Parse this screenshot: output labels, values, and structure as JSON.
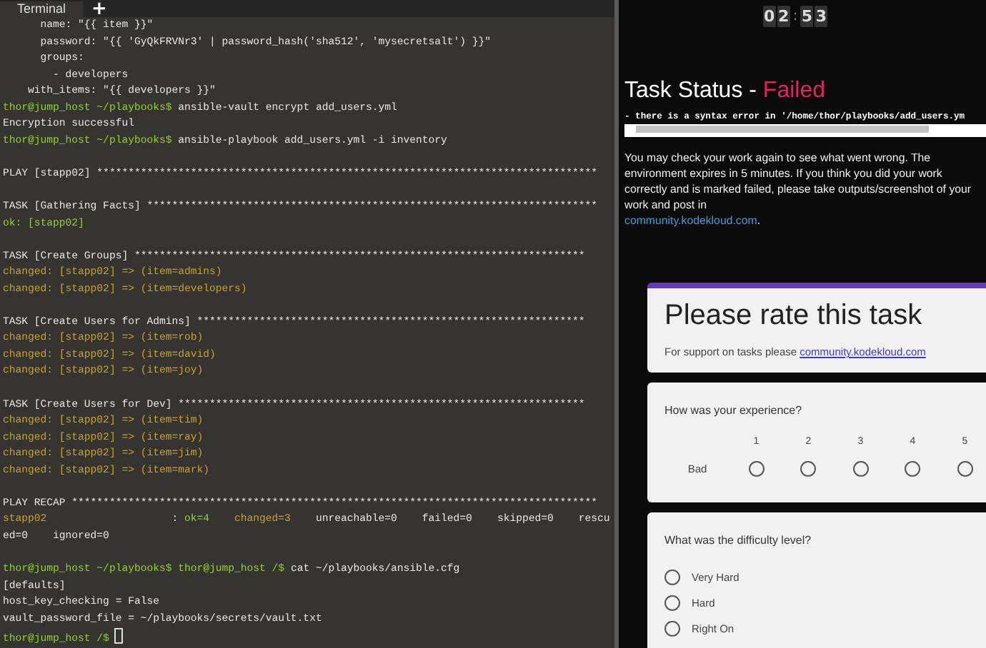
{
  "terminal": {
    "tabs": [
      {
        "label": "Terminal",
        "selected": true
      }
    ],
    "add_tab": "+",
    "lines": [
      {
        "kind": "text",
        "segments": [
          {
            "kind": "plain",
            "text": "      name: \"{{ item }}\""
          }
        ]
      },
      {
        "kind": "text",
        "segments": [
          {
            "kind": "plain",
            "text": "      password: \"{{ 'GyQkFRVNr3' | password_hash('sha512', 'mysecretsalt') }}\""
          }
        ]
      },
      {
        "kind": "text",
        "segments": [
          {
            "kind": "plain",
            "text": "      groups:"
          }
        ]
      },
      {
        "kind": "text",
        "segments": [
          {
            "kind": "plain",
            "text": "        - developers"
          }
        ]
      },
      {
        "kind": "text",
        "segments": [
          {
            "kind": "plain",
            "text": "    with_items: \"{{ developers }}\""
          }
        ]
      },
      {
        "kind": "text",
        "segments": [
          {
            "kind": "prompt",
            "text": "thor@jump_host ~/playbooks$"
          },
          {
            "kind": "plain",
            "text": " ansible-vault encrypt add_users.yml"
          }
        ]
      },
      {
        "kind": "text",
        "segments": [
          {
            "kind": "plain",
            "text": "Encryption successful"
          }
        ]
      },
      {
        "kind": "text",
        "segments": [
          {
            "kind": "prompt",
            "text": "thor@jump_host ~/playbooks$"
          },
          {
            "kind": "plain",
            "text": " ansible-playbook add_users.yml -i inventory"
          }
        ]
      },
      {
        "kind": "blank"
      },
      {
        "kind": "text",
        "segments": [
          {
            "kind": "plain",
            "text": "PLAY [stapp02] ********************************************************************************"
          }
        ]
      },
      {
        "kind": "blank"
      },
      {
        "kind": "text",
        "segments": [
          {
            "kind": "plain",
            "text": "TASK [Gathering Facts] ************************************************************************"
          }
        ]
      },
      {
        "kind": "text",
        "segments": [
          {
            "kind": "ok",
            "text": "ok: [stapp02]"
          }
        ]
      },
      {
        "kind": "blank"
      },
      {
        "kind": "text",
        "segments": [
          {
            "kind": "plain",
            "text": "TASK [Create Groups] ************************************************************************"
          }
        ]
      },
      {
        "kind": "text",
        "segments": [
          {
            "kind": "changed",
            "text": "changed: [stapp02] => (item=admins)"
          }
        ]
      },
      {
        "kind": "text",
        "segments": [
          {
            "kind": "changed",
            "text": "changed: [stapp02] => (item=developers)"
          }
        ]
      },
      {
        "kind": "blank"
      },
      {
        "kind": "text",
        "segments": [
          {
            "kind": "plain",
            "text": "TASK [Create Users for Admins] **************************************************************"
          }
        ]
      },
      {
        "kind": "text",
        "segments": [
          {
            "kind": "changed",
            "text": "changed: [stapp02] => (item=rob)"
          }
        ]
      },
      {
        "kind": "text",
        "segments": [
          {
            "kind": "changed",
            "text": "changed: [stapp02] => (item=david)"
          }
        ]
      },
      {
        "kind": "text",
        "segments": [
          {
            "kind": "changed",
            "text": "changed: [stapp02] => (item=joy)"
          }
        ]
      },
      {
        "kind": "blank"
      },
      {
        "kind": "text",
        "segments": [
          {
            "kind": "plain",
            "text": "TASK [Create Users for Dev] *****************************************************************"
          }
        ]
      },
      {
        "kind": "text",
        "segments": [
          {
            "kind": "changed",
            "text": "changed: [stapp02] => (item=tim)"
          }
        ]
      },
      {
        "kind": "text",
        "segments": [
          {
            "kind": "changed",
            "text": "changed: [stapp02] => (item=ray)"
          }
        ]
      },
      {
        "kind": "text",
        "segments": [
          {
            "kind": "changed",
            "text": "changed: [stapp02] => (item=jim)"
          }
        ]
      },
      {
        "kind": "text",
        "segments": [
          {
            "kind": "changed",
            "text": "changed: [stapp02] => (item=mark)"
          }
        ]
      },
      {
        "kind": "blank"
      },
      {
        "kind": "text",
        "segments": [
          {
            "kind": "plain",
            "text": "PLAY RECAP ************************************************************************************"
          }
        ]
      },
      {
        "kind": "text",
        "segments": [
          {
            "kind": "changed",
            "text": "stapp02"
          },
          {
            "kind": "plain",
            "text": "                    : "
          },
          {
            "kind": "ok",
            "text": "ok=4    "
          },
          {
            "kind": "changed",
            "text": "changed=3"
          },
          {
            "kind": "plain",
            "text": "    unreachable=0    failed=0    skipped=0    rescu"
          }
        ]
      },
      {
        "kind": "text",
        "segments": [
          {
            "kind": "plain",
            "text": "ed=0    ignored=0"
          }
        ]
      },
      {
        "kind": "blank"
      },
      {
        "kind": "text",
        "segments": [
          {
            "kind": "prompt",
            "text": "thor@jump_host ~/playbooks$ thor@jump_host /$"
          },
          {
            "kind": "plain",
            "text": " cat ~/playbooks/ansible.cfg"
          }
        ]
      },
      {
        "kind": "text",
        "segments": [
          {
            "kind": "plain",
            "text": "[defaults]"
          }
        ]
      },
      {
        "kind": "text",
        "segments": [
          {
            "kind": "plain",
            "text": "host_key_checking = False"
          }
        ]
      },
      {
        "kind": "text",
        "segments": [
          {
            "kind": "plain",
            "text": "vault_password_file = ~/playbooks/secrets/vault.txt"
          }
        ]
      },
      {
        "kind": "text",
        "segments": [
          {
            "kind": "prompt",
            "text": "thor@jump_host /$"
          }
        ],
        "cursor": true
      }
    ]
  },
  "timer": {
    "digits": [
      "0",
      "2",
      "5",
      "3"
    ],
    "separator": ":"
  },
  "task_status": {
    "label": "Task Status - ",
    "status": "Failed",
    "error": "- there is a syntax error in '/home/thor/playbooks/add_users.ym",
    "message": "You may check your work again to see what went wrong. The environment expires in 5 minutes. If you think you did your work correctly and is marked failed, please take outputs/screenshot of your work and post in",
    "link": "community.kodekloud.com",
    "link_suffix": "."
  },
  "form": {
    "title": "Please rate this task",
    "support_text": "For support on tasks please",
    "support_link": "community.kodekloud.com",
    "questions": [
      {
        "kind": "scale",
        "text": "How was your experience?",
        "low_label": "Bad",
        "options": [
          {
            "label": "1",
            "selected": false
          },
          {
            "label": "2",
            "selected": false
          },
          {
            "label": "3",
            "selected": false
          },
          {
            "label": "4",
            "selected": false
          },
          {
            "label": "5",
            "selected": false
          }
        ]
      },
      {
        "kind": "choice",
        "text": "What was the difficulty level?",
        "options": [
          {
            "label": "Very Hard",
            "selected": false
          },
          {
            "label": "Hard",
            "selected": false
          },
          {
            "label": "Right On",
            "selected": false
          }
        ]
      }
    ]
  }
}
